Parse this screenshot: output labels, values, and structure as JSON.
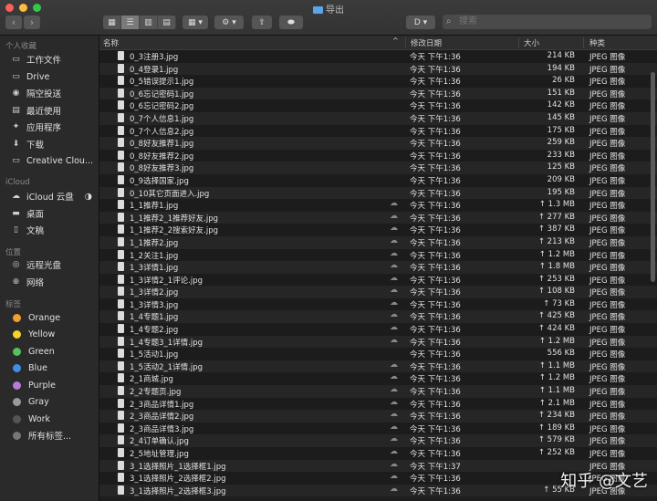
{
  "window": {
    "title": "导出"
  },
  "toolbar": {
    "back": "‹",
    "forward": "›",
    "view_buttons": [
      "▦",
      "☰",
      "▥",
      "▤"
    ],
    "group_button": "▦ ▾",
    "action_button": "⚙ ▾",
    "share_button": "⇪",
    "tag_button": "⬬",
    "app_button": "D ▾",
    "search_placeholder": "搜索"
  },
  "sidebar": {
    "sections": [
      {
        "title": "个人收藏",
        "items": [
          {
            "label": "工作文件",
            "icon": "folder-icon"
          },
          {
            "label": "Drive",
            "icon": "folder-icon"
          },
          {
            "label": "隔空投送",
            "icon": "airdrop-icon"
          },
          {
            "label": "最近使用",
            "icon": "recents-icon"
          },
          {
            "label": "应用程序",
            "icon": "applications-icon"
          },
          {
            "label": "下载",
            "icon": "download-icon"
          },
          {
            "label": "Creative Clou...",
            "icon": "folder-icon"
          }
        ]
      },
      {
        "title": "iCloud",
        "items": [
          {
            "label": "iCloud 云盘",
            "icon": "cloud-icon"
          },
          {
            "label": "桌面",
            "icon": "desktop-icon"
          },
          {
            "label": "文稿",
            "icon": "documents-icon"
          }
        ]
      },
      {
        "title": "位置",
        "items": [
          {
            "label": "远程光盘",
            "icon": "disc-icon"
          },
          {
            "label": "网络",
            "icon": "network-icon"
          }
        ]
      },
      {
        "title": "标签",
        "tags": [
          {
            "label": "Orange",
            "color": "#f0a030"
          },
          {
            "label": "Yellow",
            "color": "#f5d328"
          },
          {
            "label": "Green",
            "color": "#56c05a"
          },
          {
            "label": "Blue",
            "color": "#3f8fe8"
          },
          {
            "label": "Purple",
            "color": "#b87ad6"
          },
          {
            "label": "Gray",
            "color": "#9a9a9a"
          },
          {
            "label": "Work",
            "color": "#555555"
          },
          {
            "label": "所有标签...",
            "color": "#777777"
          }
        ]
      }
    ]
  },
  "columns": {
    "name": "名称",
    "date": "修改日期",
    "size": "大小",
    "kind": "种类"
  },
  "files": [
    {
      "name": "0_3注册3.jpg",
      "date": "今天 下午1:36",
      "size": "214 KB",
      "kind": "JPEG 图像",
      "cloud": false
    },
    {
      "name": "0_4登录1.jpg",
      "date": "今天 下午1:36",
      "size": "194 KB",
      "kind": "JPEG 图像",
      "cloud": false
    },
    {
      "name": "0_5错误提示1.jpg",
      "date": "今天 下午1:36",
      "size": "26 KB",
      "kind": "JPEG 图像",
      "cloud": false
    },
    {
      "name": "0_6忘记密码1.jpg",
      "date": "今天 下午1:36",
      "size": "151 KB",
      "kind": "JPEG 图像",
      "cloud": false
    },
    {
      "name": "0_6忘记密码2.jpg",
      "date": "今天 下午1:36",
      "size": "142 KB",
      "kind": "JPEG 图像",
      "cloud": false
    },
    {
      "name": "0_7个人信息1.jpg",
      "date": "今天 下午1:36",
      "size": "145 KB",
      "kind": "JPEG 图像",
      "cloud": false
    },
    {
      "name": "0_7个人信息2.jpg",
      "date": "今天 下午1:36",
      "size": "175 KB",
      "kind": "JPEG 图像",
      "cloud": false
    },
    {
      "name": "0_8好友推荐1.jpg",
      "date": "今天 下午1:36",
      "size": "259 KB",
      "kind": "JPEG 图像",
      "cloud": false
    },
    {
      "name": "0_8好友推荐2.jpg",
      "date": "今天 下午1:36",
      "size": "233 KB",
      "kind": "JPEG 图像",
      "cloud": false
    },
    {
      "name": "0_8好友推荐3.jpg",
      "date": "今天 下午1:36",
      "size": "125 KB",
      "kind": "JPEG 图像",
      "cloud": false
    },
    {
      "name": "0_9选择国家.jpg",
      "date": "今天 下午1:36",
      "size": "209 KB",
      "kind": "JPEG 图像",
      "cloud": false
    },
    {
      "name": "0_10其它页面进入.jpg",
      "date": "今天 下午1:36",
      "size": "195 KB",
      "kind": "JPEG 图像",
      "cloud": false
    },
    {
      "name": "1_1推荐1.jpg",
      "date": "今天 下午1:36",
      "size": "↑ 1.3 MB",
      "kind": "JPEG 图像",
      "cloud": true
    },
    {
      "name": "1_1推荐2_1推荐好友.jpg",
      "date": "今天 下午1:36",
      "size": "↑ 277 KB",
      "kind": "JPEG 图像",
      "cloud": true
    },
    {
      "name": "1_1推荐2_2搜索好友.jpg",
      "date": "今天 下午1:36",
      "size": "↑ 387 KB",
      "kind": "JPEG 图像",
      "cloud": true
    },
    {
      "name": "1_1推荐2.jpg",
      "date": "今天 下午1:36",
      "size": "↑ 213 KB",
      "kind": "JPEG 图像",
      "cloud": true
    },
    {
      "name": "1_2关注1.jpg",
      "date": "今天 下午1:36",
      "size": "↑ 1.2 MB",
      "kind": "JPEG 图像",
      "cloud": true
    },
    {
      "name": "1_3详情1.jpg",
      "date": "今天 下午1:36",
      "size": "↑ 1.8 MB",
      "kind": "JPEG 图像",
      "cloud": true
    },
    {
      "name": "1_3详情2_1评论.jpg",
      "date": "今天 下午1:36",
      "size": "↑ 253 KB",
      "kind": "JPEG 图像",
      "cloud": true
    },
    {
      "name": "1_3详情2.jpg",
      "date": "今天 下午1:36",
      "size": "↑ 108 KB",
      "kind": "JPEG 图像",
      "cloud": true
    },
    {
      "name": "1_3详情3.jpg",
      "date": "今天 下午1:36",
      "size": "↑ 73 KB",
      "kind": "JPEG 图像",
      "cloud": true
    },
    {
      "name": "1_4专题1.jpg",
      "date": "今天 下午1:36",
      "size": "↑ 425 KB",
      "kind": "JPEG 图像",
      "cloud": true
    },
    {
      "name": "1_4专题2.jpg",
      "date": "今天 下午1:36",
      "size": "↑ 424 KB",
      "kind": "JPEG 图像",
      "cloud": true
    },
    {
      "name": "1_4专题3_1详情.jpg",
      "date": "今天 下午1:36",
      "size": "↑ 1.2 MB",
      "kind": "JPEG 图像",
      "cloud": true
    },
    {
      "name": "1_5活动1.jpg",
      "date": "今天 下午1:36",
      "size": "556 KB",
      "kind": "JPEG 图像",
      "cloud": false
    },
    {
      "name": "1_5活动2_1详情.jpg",
      "date": "今天 下午1:36",
      "size": "↑ 1.1 MB",
      "kind": "JPEG 图像",
      "cloud": true
    },
    {
      "name": "2_1商城.jpg",
      "date": "今天 下午1:36",
      "size": "↑ 1.2 MB",
      "kind": "JPEG 图像",
      "cloud": true
    },
    {
      "name": "2_2专题页.jpg",
      "date": "今天 下午1:36",
      "size": "↑ 1.1 MB",
      "kind": "JPEG 图像",
      "cloud": true
    },
    {
      "name": "2_3商品详情1.jpg",
      "date": "今天 下午1:36",
      "size": "↑ 2.1 MB",
      "kind": "JPEG 图像",
      "cloud": true
    },
    {
      "name": "2_3商品详情2.jpg",
      "date": "今天 下午1:36",
      "size": "↑ 234 KB",
      "kind": "JPEG 图像",
      "cloud": true
    },
    {
      "name": "2_3商品详情3.jpg",
      "date": "今天 下午1:36",
      "size": "↑ 189 KB",
      "kind": "JPEG 图像",
      "cloud": true
    },
    {
      "name": "2_4订单确认.jpg",
      "date": "今天 下午1:36",
      "size": "↑ 579 KB",
      "kind": "JPEG 图像",
      "cloud": true
    },
    {
      "name": "2_5地址管理.jpg",
      "date": "今天 下午1:36",
      "size": "↑ 252 KB",
      "kind": "JPEG 图像",
      "cloud": true
    },
    {
      "name": "3_1选择照片_1选择框1.jpg",
      "date": "今天 下午1:37",
      "size": "",
      "kind": "JPEG 图像",
      "cloud": true
    },
    {
      "name": "3_1选择照片_2选择框2.jpg",
      "date": "今天 下午1:36",
      "size": "",
      "kind": "JPEG 图像",
      "cloud": true
    },
    {
      "name": "3_1选择照片_2选择框3.jpg",
      "date": "今天 下午1:36",
      "size": "↑ 55 KB",
      "kind": "JPEG 图像",
      "cloud": true
    }
  ],
  "watermark": "知乎 @文艺"
}
